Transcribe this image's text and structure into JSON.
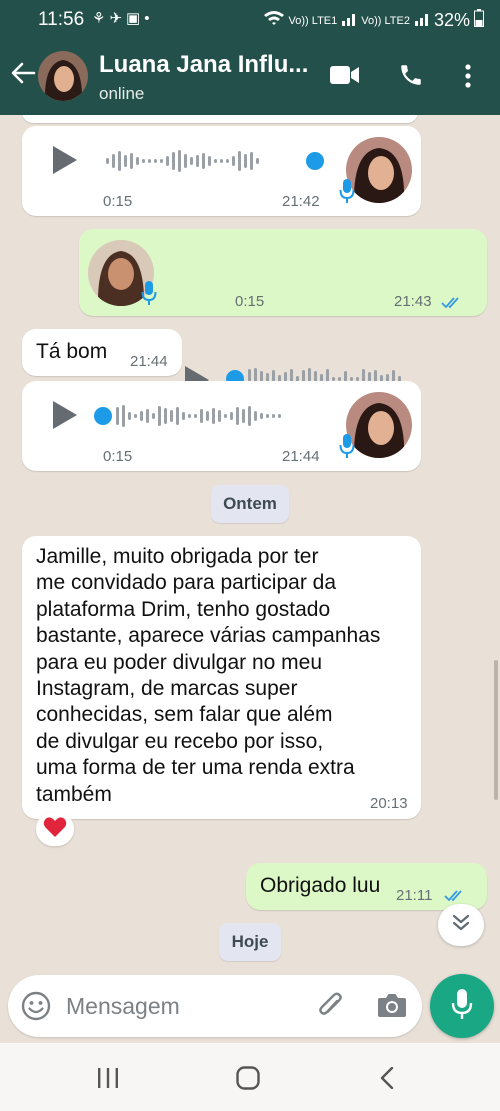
{
  "status_bar": {
    "time": "11:56",
    "battery": "32%",
    "net1": "Vo)) LTE1",
    "net2": "Vo)) LTE2"
  },
  "header": {
    "contact_name": "Luana Jana Influ...",
    "status": "online"
  },
  "messages": [
    {
      "kind": "voice",
      "direction": "in",
      "duration": "0:15",
      "time": "21:42",
      "progress": 1.0
    },
    {
      "kind": "voice",
      "direction": "out",
      "duration": "0:15",
      "time": "21:43",
      "progress": 0.0,
      "read": true
    },
    {
      "kind": "text",
      "direction": "in",
      "text": "Tá bom",
      "time": "21:44"
    },
    {
      "kind": "voice",
      "direction": "in",
      "duration": "0:15",
      "time": "21:44",
      "progress": 0.0
    },
    {
      "kind": "date",
      "label": "Ontem"
    },
    {
      "kind": "text",
      "direction": "in",
      "lines": [
        "Jamille, muito obrigada por ter",
        "me convidado para participar da",
        "plataforma Drim, tenho gostado",
        "bastante, aparece várias campanhas",
        "para eu poder divulgar no meu",
        "Instagram, de marcas super",
        "conhecidas, sem falar que além",
        "de divulgar eu recebo por isso,",
        "uma forma de ter uma renda extra",
        "também"
      ],
      "time": "20:13",
      "reaction": "heart"
    },
    {
      "kind": "text",
      "direction": "out",
      "text": "Obrigado luu",
      "time": "21:11",
      "read": true
    },
    {
      "kind": "date",
      "label": "Hoje"
    }
  ],
  "composer": {
    "placeholder": "Mensagem"
  },
  "icons": {
    "back": "arrow-left-icon",
    "video": "video-call-icon",
    "call": "phone-icon",
    "menu": "more-vert-icon",
    "emoji": "emoji-icon",
    "attach": "paperclip-icon",
    "camera": "camera-icon",
    "mic": "mic-icon"
  },
  "colors": {
    "header": "#23504a",
    "accent": "#1aa884",
    "outgoing_bubble": "#dcf8c6",
    "incoming_bubble": "#ffffff",
    "read_ticks": "#3498e8",
    "wallpaper": "#e9e1d7"
  }
}
